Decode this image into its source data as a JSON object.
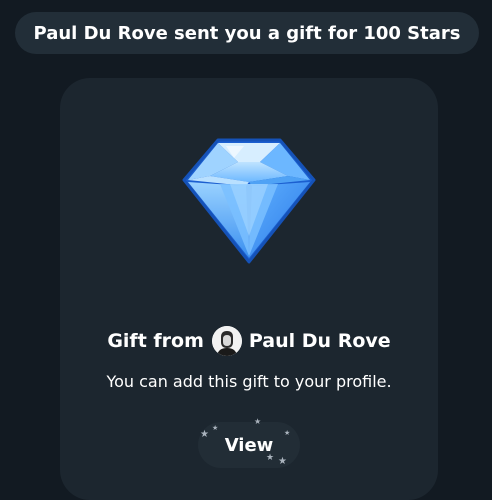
{
  "service_message": "Paul Du Rove sent you a gift for 100 Stars",
  "gift": {
    "title_prefix": "Gift from",
    "sender_name": "Paul Du Rove",
    "description": "You can add this gift to your profile.",
    "icon": "diamond-icon"
  },
  "actions": {
    "view_label": "View"
  },
  "colors": {
    "background": "#121a22",
    "card": "#1c262f",
    "pill": "#222e38",
    "diamond_light": "#7cc4ff",
    "diamond_dark": "#1e66d0"
  }
}
